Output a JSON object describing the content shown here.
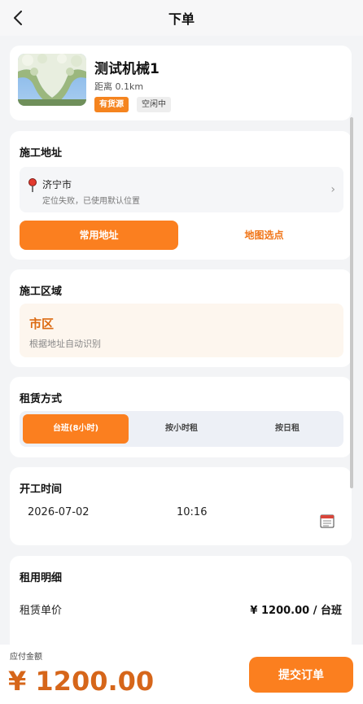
{
  "nav": {
    "title": "下单",
    "back_icon": "chevron-left-icon"
  },
  "machine": {
    "name": "测试机械1",
    "distance": "距离 0.1km",
    "badges": [
      "有货源",
      "空闲中"
    ]
  },
  "address": {
    "title": "施工地址",
    "city": "济宁市",
    "subtitle": "定位失败，已使用默认位置",
    "common_button": "常用地址",
    "map_button": "地图选点"
  },
  "area": {
    "title": "施工区域",
    "name": "市区",
    "subtitle": "根据地址自动识别"
  },
  "rent_mode": {
    "title": "租赁方式",
    "options": [
      "台班(8小时)",
      "按小时租",
      "按日租"
    ],
    "selected": "台班(8小时)"
  },
  "start_time": {
    "title": "开工时间",
    "date": "2026-07-02",
    "time": "10:16"
  },
  "detail": {
    "title": "租用明细",
    "unit_price_label": "租赁单价",
    "unit_price_value": "¥ 1200.00 / 台班"
  },
  "footer": {
    "pay_label": "应付金额",
    "pay_amount": "¥ 1200.00",
    "submit_label": "提交订单"
  },
  "colors": {
    "accent": "#fb7f1f",
    "accent_text": "#d6661a",
    "background": "#f3f4f6"
  }
}
